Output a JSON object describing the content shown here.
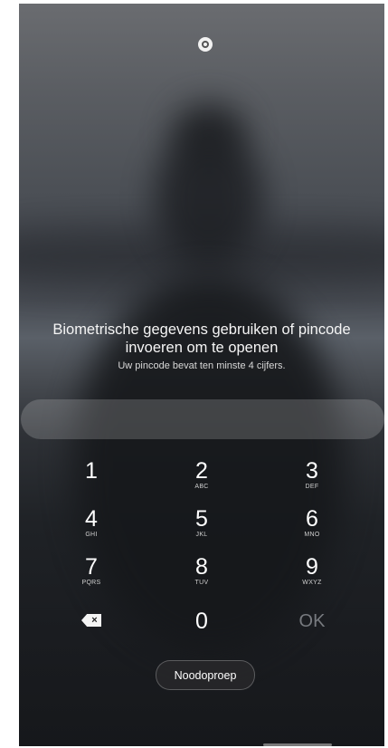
{
  "lockscreen": {
    "prompt_line1": "Biometrische gegevens gebruiken of pincode",
    "prompt_line2": "invoeren om te openen",
    "hint": "Uw pincode bevat ten minste 4 cijfers.",
    "pin_value": ""
  },
  "keypad": {
    "keys": [
      {
        "digit": "1",
        "letters": ""
      },
      {
        "digit": "2",
        "letters": "ABC"
      },
      {
        "digit": "3",
        "letters": "DEF"
      },
      {
        "digit": "4",
        "letters": "GHI"
      },
      {
        "digit": "5",
        "letters": "JKL"
      },
      {
        "digit": "6",
        "letters": "MNO"
      },
      {
        "digit": "7",
        "letters": "PQRS"
      },
      {
        "digit": "8",
        "letters": "TUV"
      },
      {
        "digit": "9",
        "letters": "WXYZ"
      },
      {
        "digit": "0",
        "letters": ""
      }
    ],
    "backspace_icon": "backspace-icon",
    "backspace_glyph": "×",
    "ok_label": "OK"
  },
  "emergency_button": "Noodoproep",
  "icons": {
    "top": "face-unlock-icon"
  },
  "colors": {
    "text": "#ffffff",
    "ok_disabled": "#777a7f",
    "pin_field": "rgba(255,255,255,0.18)"
  }
}
